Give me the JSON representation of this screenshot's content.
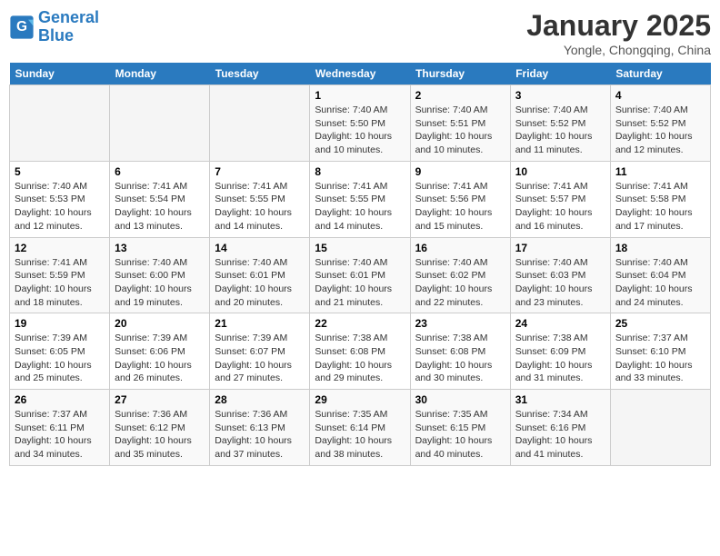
{
  "header": {
    "logo_line1": "General",
    "logo_line2": "Blue",
    "title": "January 2025",
    "subtitle": "Yongle, Chongqing, China"
  },
  "days_of_week": [
    "Sunday",
    "Monday",
    "Tuesday",
    "Wednesday",
    "Thursday",
    "Friday",
    "Saturday"
  ],
  "weeks": [
    {
      "row_class": "row-odd",
      "days": [
        {
          "num": "",
          "info": "",
          "empty": true
        },
        {
          "num": "",
          "info": "",
          "empty": true
        },
        {
          "num": "",
          "info": "",
          "empty": true
        },
        {
          "num": "1",
          "info": "Sunrise: 7:40 AM\nSunset: 5:50 PM\nDaylight: 10 hours\nand 10 minutes.",
          "empty": false
        },
        {
          "num": "2",
          "info": "Sunrise: 7:40 AM\nSunset: 5:51 PM\nDaylight: 10 hours\nand 10 minutes.",
          "empty": false
        },
        {
          "num": "3",
          "info": "Sunrise: 7:40 AM\nSunset: 5:52 PM\nDaylight: 10 hours\nand 11 minutes.",
          "empty": false
        },
        {
          "num": "4",
          "info": "Sunrise: 7:40 AM\nSunset: 5:52 PM\nDaylight: 10 hours\nand 12 minutes.",
          "empty": false
        }
      ]
    },
    {
      "row_class": "row-even",
      "days": [
        {
          "num": "5",
          "info": "Sunrise: 7:40 AM\nSunset: 5:53 PM\nDaylight: 10 hours\nand 12 minutes.",
          "empty": false
        },
        {
          "num": "6",
          "info": "Sunrise: 7:41 AM\nSunset: 5:54 PM\nDaylight: 10 hours\nand 13 minutes.",
          "empty": false
        },
        {
          "num": "7",
          "info": "Sunrise: 7:41 AM\nSunset: 5:55 PM\nDaylight: 10 hours\nand 14 minutes.",
          "empty": false
        },
        {
          "num": "8",
          "info": "Sunrise: 7:41 AM\nSunset: 5:55 PM\nDaylight: 10 hours\nand 14 minutes.",
          "empty": false
        },
        {
          "num": "9",
          "info": "Sunrise: 7:41 AM\nSunset: 5:56 PM\nDaylight: 10 hours\nand 15 minutes.",
          "empty": false
        },
        {
          "num": "10",
          "info": "Sunrise: 7:41 AM\nSunset: 5:57 PM\nDaylight: 10 hours\nand 16 minutes.",
          "empty": false
        },
        {
          "num": "11",
          "info": "Sunrise: 7:41 AM\nSunset: 5:58 PM\nDaylight: 10 hours\nand 17 minutes.",
          "empty": false
        }
      ]
    },
    {
      "row_class": "row-odd",
      "days": [
        {
          "num": "12",
          "info": "Sunrise: 7:41 AM\nSunset: 5:59 PM\nDaylight: 10 hours\nand 18 minutes.",
          "empty": false
        },
        {
          "num": "13",
          "info": "Sunrise: 7:40 AM\nSunset: 6:00 PM\nDaylight: 10 hours\nand 19 minutes.",
          "empty": false
        },
        {
          "num": "14",
          "info": "Sunrise: 7:40 AM\nSunset: 6:01 PM\nDaylight: 10 hours\nand 20 minutes.",
          "empty": false
        },
        {
          "num": "15",
          "info": "Sunrise: 7:40 AM\nSunset: 6:01 PM\nDaylight: 10 hours\nand 21 minutes.",
          "empty": false
        },
        {
          "num": "16",
          "info": "Sunrise: 7:40 AM\nSunset: 6:02 PM\nDaylight: 10 hours\nand 22 minutes.",
          "empty": false
        },
        {
          "num": "17",
          "info": "Sunrise: 7:40 AM\nSunset: 6:03 PM\nDaylight: 10 hours\nand 23 minutes.",
          "empty": false
        },
        {
          "num": "18",
          "info": "Sunrise: 7:40 AM\nSunset: 6:04 PM\nDaylight: 10 hours\nand 24 minutes.",
          "empty": false
        }
      ]
    },
    {
      "row_class": "row-even",
      "days": [
        {
          "num": "19",
          "info": "Sunrise: 7:39 AM\nSunset: 6:05 PM\nDaylight: 10 hours\nand 25 minutes.",
          "empty": false
        },
        {
          "num": "20",
          "info": "Sunrise: 7:39 AM\nSunset: 6:06 PM\nDaylight: 10 hours\nand 26 minutes.",
          "empty": false
        },
        {
          "num": "21",
          "info": "Sunrise: 7:39 AM\nSunset: 6:07 PM\nDaylight: 10 hours\nand 27 minutes.",
          "empty": false
        },
        {
          "num": "22",
          "info": "Sunrise: 7:38 AM\nSunset: 6:08 PM\nDaylight: 10 hours\nand 29 minutes.",
          "empty": false
        },
        {
          "num": "23",
          "info": "Sunrise: 7:38 AM\nSunset: 6:08 PM\nDaylight: 10 hours\nand 30 minutes.",
          "empty": false
        },
        {
          "num": "24",
          "info": "Sunrise: 7:38 AM\nSunset: 6:09 PM\nDaylight: 10 hours\nand 31 minutes.",
          "empty": false
        },
        {
          "num": "25",
          "info": "Sunrise: 7:37 AM\nSunset: 6:10 PM\nDaylight: 10 hours\nand 33 minutes.",
          "empty": false
        }
      ]
    },
    {
      "row_class": "row-odd",
      "days": [
        {
          "num": "26",
          "info": "Sunrise: 7:37 AM\nSunset: 6:11 PM\nDaylight: 10 hours\nand 34 minutes.",
          "empty": false
        },
        {
          "num": "27",
          "info": "Sunrise: 7:36 AM\nSunset: 6:12 PM\nDaylight: 10 hours\nand 35 minutes.",
          "empty": false
        },
        {
          "num": "28",
          "info": "Sunrise: 7:36 AM\nSunset: 6:13 PM\nDaylight: 10 hours\nand 37 minutes.",
          "empty": false
        },
        {
          "num": "29",
          "info": "Sunrise: 7:35 AM\nSunset: 6:14 PM\nDaylight: 10 hours\nand 38 minutes.",
          "empty": false
        },
        {
          "num": "30",
          "info": "Sunrise: 7:35 AM\nSunset: 6:15 PM\nDaylight: 10 hours\nand 40 minutes.",
          "empty": false
        },
        {
          "num": "31",
          "info": "Sunrise: 7:34 AM\nSunset: 6:16 PM\nDaylight: 10 hours\nand 41 minutes.",
          "empty": false
        },
        {
          "num": "",
          "info": "",
          "empty": true
        }
      ]
    }
  ]
}
